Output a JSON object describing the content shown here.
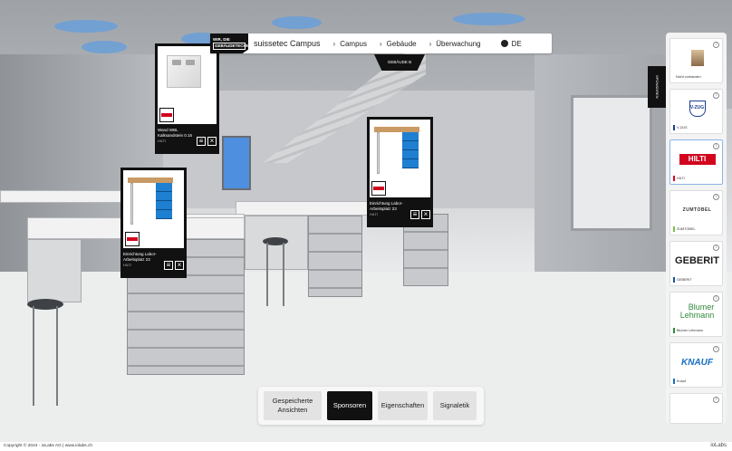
{
  "nav": {
    "logo_line1": "WIR, DIE",
    "logo_line2": "GEBÄUDETECHNIKER",
    "brand": "suissetec Campus",
    "crumbs": [
      "Campus",
      "Gebäude",
      "Überwachung"
    ],
    "language": "DE",
    "help_label": "?",
    "building_tab": "GEBÄUDE B"
  },
  "popups": [
    {
      "title": "Wand WBL Kalksandstein 0.15",
      "brand": "HILTI"
    },
    {
      "title": "Einrichtung Labor-Arbeitsplatz 23",
      "brand": "HILTI"
    },
    {
      "title": "Einrichtung Labor-Arbeitsplatz 23",
      "brand": "HILTI"
    }
  ],
  "sponsor_flag": "SPONSOREN",
  "sponsors": [
    {
      "label": "Nicht vorhanden",
      "color": "#ffffff"
    },
    {
      "label": "V-ZUG",
      "color": "#1d3f8f",
      "logo": "V-ZUG"
    },
    {
      "label": "HILTI",
      "color": "#d2051e",
      "logo": "HILTI"
    },
    {
      "label": "ZUMTOBEL",
      "color": "#7bc043",
      "logo": "ZUMTOBEL"
    },
    {
      "label": "GEBERIT",
      "color": "#1d4fa0",
      "logo": "GEBERIT"
    },
    {
      "label": "Blumer Lehmann",
      "color": "#2e8b3a",
      "logo1": "Blumer",
      "logo2": "Lehmann"
    },
    {
      "label": "Knauf",
      "color": "#1a6fc2",
      "logo": "KNAUF"
    }
  ],
  "toolbar": {
    "saved_views_line1": "Gespeicherte",
    "saved_views_line2": "Ansichten",
    "sponsors": "Sponsoren",
    "properties": "Eigenschaften",
    "signage": "Signaletik"
  },
  "footer": {
    "copyright": "Copyright © 2024 - ioLabs AG | www.iolabs.ch",
    "brand": "ioLabs"
  }
}
